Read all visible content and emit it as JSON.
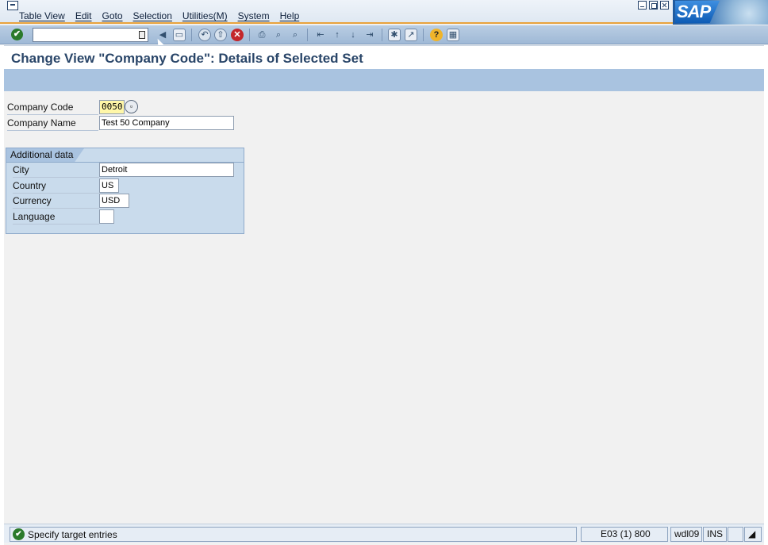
{
  "menubar": {
    "items": [
      "Table View",
      "Edit",
      "Goto",
      "Selection",
      "Utilities(M)",
      "System",
      "Help"
    ]
  },
  "logo": {
    "text": "SAP"
  },
  "toolbar": {
    "command_field_value": "",
    "icons": [
      "enter-icon",
      "back-icon",
      "save-icon",
      "back-nav-icon",
      "exit-icon",
      "cancel-icon",
      "print-icon",
      "find-icon",
      "find-next-icon",
      "first-page-icon",
      "prev-page-icon",
      "next-page-icon",
      "last-page-icon",
      "new-session-icon",
      "shortcut-icon",
      "help-icon",
      "layout-icon"
    ]
  },
  "title": "Change View \"Company Code\": Details of Selected Set",
  "form": {
    "company_code_label": "Company Code",
    "company_code_value": "0050",
    "company_name_label": "Company Name",
    "company_name_value": "Test 50 Company"
  },
  "additional_data": {
    "heading": "Additional data",
    "city_label": "City",
    "city_value": "Detroit",
    "country_label": "Country",
    "country_value": "US",
    "currency_label": "Currency",
    "currency_value": "USD",
    "language_label": "Language",
    "language_value": ""
  },
  "status": {
    "message": "Specify target entries",
    "system": "E03 (1) 800",
    "server": "wdl09",
    "mode": "INS"
  },
  "colors": {
    "title": "#2a4669",
    "toolbar": "#a9c3e0",
    "key_field": "#fff7a8",
    "group_box": "#c9dbec",
    "accent_line": "#e8a23c"
  }
}
